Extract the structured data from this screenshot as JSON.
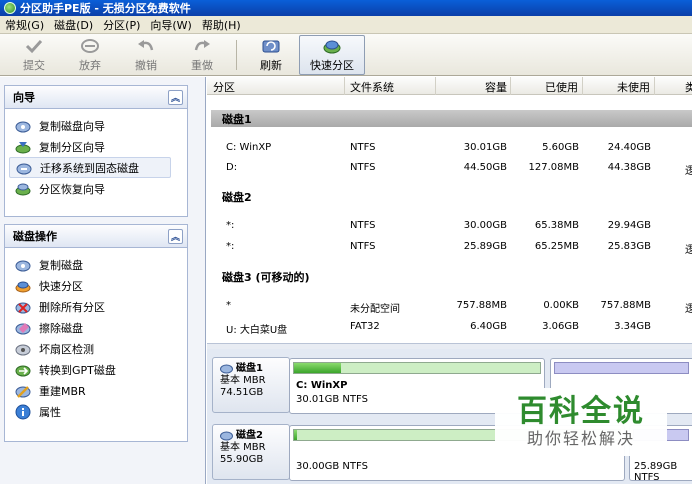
{
  "window": {
    "title": "分区助手PE版 - 无损分区免费软件"
  },
  "menu": [
    "常规(G)",
    "磁盘(D)",
    "分区(P)",
    "向导(W)",
    "帮助(H)"
  ],
  "toolbar": {
    "commit": "提交",
    "discard": "放弃",
    "undo": "撤销",
    "redo": "重做",
    "refresh": "刷新",
    "quick_partition": "快速分区"
  },
  "wizards": {
    "title": "向导",
    "items": [
      "复制磁盘向导",
      "复制分区向导",
      "迁移系统到固态磁盘",
      "分区恢复向导"
    ]
  },
  "disk_ops": {
    "title": "磁盘操作",
    "items": [
      "复制磁盘",
      "快速分区",
      "删除所有分区",
      "擦除磁盘",
      "坏扇区检测",
      "转换到GPT磁盘",
      "重建MBR",
      "属性"
    ]
  },
  "table": {
    "headers": {
      "partition": "分区",
      "fs": "文件系统",
      "capacity": "容量",
      "used": "已使用",
      "unused": "未使用",
      "type": "类"
    },
    "disks": [
      {
        "title": "磁盘1",
        "rows": [
          {
            "p": "C: WinXP",
            "fs": "NTFS",
            "cap": "30.01GB",
            "used": "5.60GB",
            "free": "24.40GB",
            "type": ""
          },
          {
            "p": "D:",
            "fs": "NTFS",
            "cap": "44.50GB",
            "used": "127.08MB",
            "free": "44.38GB",
            "type": "逻"
          }
        ]
      },
      {
        "title": "磁盘2",
        "rows": [
          {
            "p": "*:",
            "fs": "NTFS",
            "cap": "30.00GB",
            "used": "65.38MB",
            "free": "29.94GB",
            "type": ""
          },
          {
            "p": "*:",
            "fs": "NTFS",
            "cap": "25.89GB",
            "used": "65.25MB",
            "free": "25.83GB",
            "type": "逻"
          }
        ]
      },
      {
        "title": "磁盘3 (可移动的)",
        "rows": [
          {
            "p": "*",
            "fs": "未分配空间",
            "cap": "757.88MB",
            "used": "0.00KB",
            "free": "757.88MB",
            "type": "逻"
          },
          {
            "p": "U: 大白菜U盘",
            "fs": "FAT32",
            "cap": "6.40GB",
            "used": "3.06GB",
            "free": "3.34GB",
            "type": ""
          }
        ]
      }
    ]
  },
  "diskmap": {
    "disk1": {
      "title": "磁盘1",
      "type": "基本 MBR",
      "size": "74.51GB",
      "p1": {
        "name": "C: WinXP",
        "desc": "30.01GB NTFS",
        "used_fraction": 0.19
      }
    },
    "disk2": {
      "title": "磁盘2",
      "type": "基本 MBR",
      "size": "55.90GB",
      "p1": {
        "desc": "30.00GB NTFS",
        "used_fraction": 0.01
      },
      "p2": {
        "desc": "25.89GB NTFS"
      }
    }
  },
  "watermark": {
    "title": "百科全说",
    "subtitle": "助你轻松解决"
  }
}
